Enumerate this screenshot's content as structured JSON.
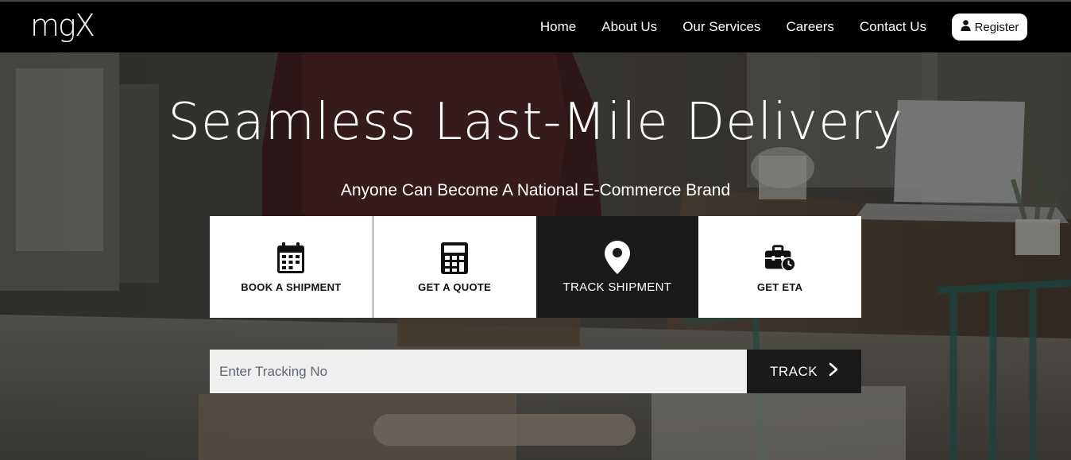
{
  "brand": {
    "logo_text": "mgX"
  },
  "nav": {
    "links": [
      "Home",
      "About Us",
      "Our Services",
      "Careers",
      "Contact Us"
    ],
    "register_label": "Register"
  },
  "hero": {
    "title": "Seamless Last-Mile Delivery",
    "subtitle": "Anyone Can Become A National E-Commerce Brand"
  },
  "tiles": [
    {
      "label": "BOOK A SHIPMENT",
      "icon": "calendar-icon",
      "active": false
    },
    {
      "label": "GET A QUOTE",
      "icon": "calculator-icon",
      "active": false
    },
    {
      "label": "TRACK SHIPMENT",
      "icon": "map-pin-icon",
      "active": true
    },
    {
      "label": "GET ETA",
      "icon": "briefcase-clock-icon",
      "active": false
    }
  ],
  "track": {
    "placeholder": "Enter Tracking No",
    "button_label": "TRACK"
  },
  "colors": {
    "navbar": "#000000",
    "tile_bg": "#ffffff",
    "tile_active_bg": "#1a1a1a",
    "input_bg": "#efefef"
  }
}
